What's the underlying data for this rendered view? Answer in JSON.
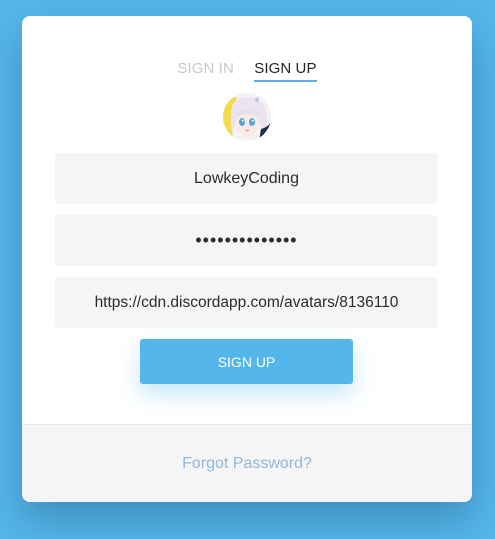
{
  "tabs": {
    "sign_in": "SIGN IN",
    "sign_up": "SIGN UP"
  },
  "form": {
    "username_value": "LowkeyCoding",
    "password_value": "••••••••••••••",
    "avatar_url_value": "https://cdn.discordapp.com/avatars/8136110"
  },
  "submit_label": "SIGN UP",
  "footer": {
    "forgot_label": "Forgot Password?"
  },
  "colors": {
    "background": "#55b6ea",
    "accent": "#55b6ea",
    "link": "#8fb9dd"
  },
  "avatar": {
    "icon": "profile-avatar-image"
  }
}
